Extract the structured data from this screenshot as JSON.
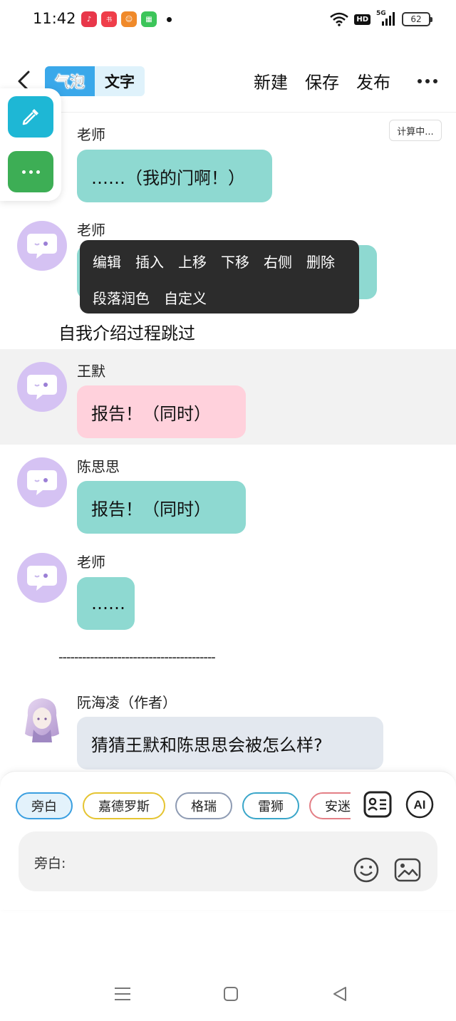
{
  "status_bar": {
    "time": "11:42",
    "app_icons": [
      {
        "name": "music-app-icon",
        "color": "#e8374a"
      },
      {
        "name": "xiaohongshu-app-icon",
        "color": "#ef3e4a"
      },
      {
        "name": "game-app-icon",
        "color": "#f08a2a"
      },
      {
        "name": "green-app-icon",
        "color": "#3cc55a"
      }
    ],
    "hd_label": "HD",
    "network_label": "5G",
    "battery_level": "62"
  },
  "header": {
    "tabs": [
      {
        "label": "气泡",
        "active": true
      },
      {
        "label": "文字",
        "active": false
      }
    ],
    "actions": [
      "新建",
      "保存",
      "发布"
    ]
  },
  "calc_badge": "计算中...",
  "messages": [
    {
      "sender": "老师",
      "text": "……（我的门啊！）",
      "color": "teal"
    },
    {
      "sender": "老师",
      "text": "",
      "color": "teal"
    },
    {
      "narration": "自我介绍过程跳过"
    },
    {
      "sender": "王默",
      "text": "报告！（同时）",
      "color": "pink"
    },
    {
      "sender": "陈思思",
      "text": "报告！（同时）",
      "color": "teal"
    },
    {
      "sender": "老师",
      "text": "……",
      "color": "teal"
    },
    {
      "divider": "----------------------------------------"
    },
    {
      "sender": "阮海凌（作者）",
      "text": "猜猜王默和陈思思会被怎么样?",
      "color": "grey"
    }
  ],
  "context_menu": {
    "row1": [
      "编辑",
      "插入",
      "上移",
      "下移",
      "右侧",
      "删除"
    ],
    "row2": [
      "段落润色",
      "自定义"
    ]
  },
  "characters": [
    "旁白",
    "嘉德罗斯",
    "格瑞",
    "雷狮",
    "安迷修"
  ],
  "input": {
    "label": "旁白:"
  },
  "colors": {
    "accent_blue": "#3aa8ea",
    "teal_bubble": "#8ed9d1",
    "pink_bubble": "#ffd1dc",
    "grey_bubble": "#e3e8ef",
    "avatar_purple": "#d5c2f3"
  }
}
